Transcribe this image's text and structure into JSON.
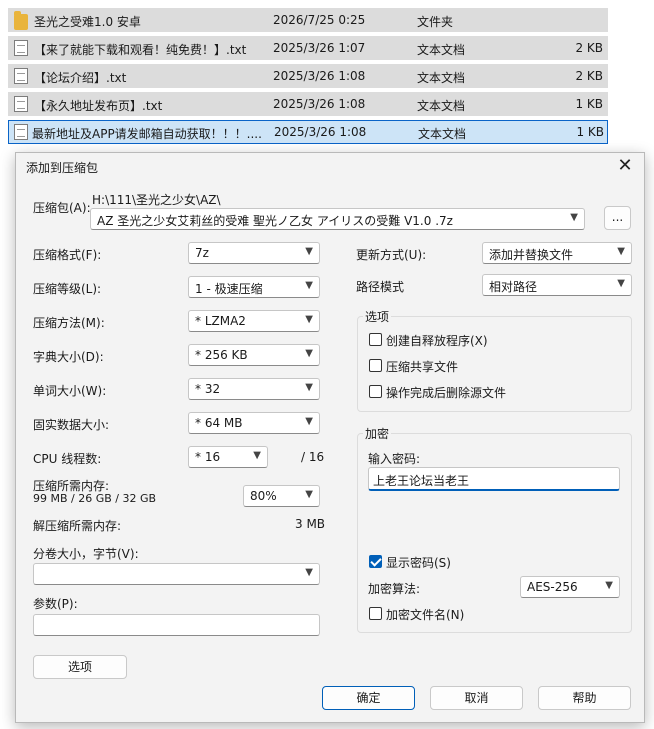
{
  "files": [
    {
      "name": "圣光之受难1.0 安卓",
      "date": "2026/7/25 0:25",
      "type": "文件夹",
      "size": "",
      "icon": "folder-icon"
    },
    {
      "name": "【来了就能下载和观看！纯免费！】.txt",
      "date": "2025/3/26 1:07",
      "type": "文本文档",
      "size": "2 KB",
      "icon": "text-file-icon"
    },
    {
      "name": "【论坛介绍】.txt",
      "date": "2025/3/26 1:08",
      "type": "文本文档",
      "size": "2 KB",
      "icon": "text-file-icon"
    },
    {
      "name": "【永久地址发布页】.txt",
      "date": "2025/3/26 1:08",
      "type": "文本文档",
      "size": "1 KB",
      "icon": "text-file-icon"
    },
    {
      "name": "最新地址及APP请发邮箱自动获取！！！....",
      "date": "2025/3/26 1:08",
      "type": "文本文档",
      "size": "1 KB",
      "icon": "text-file-icon"
    }
  ],
  "dialog": {
    "title": "添加到压缩包",
    "close": "✕",
    "archive_label": "压缩包(A):",
    "archive_path": "H:\\111\\圣光之少女\\AZ\\",
    "archive_name": "AZ 圣光之少女艾莉丝的受难 聖光ノ乙女 アイリスの受難 V1.0 .7z",
    "browse_label": "...",
    "format_label": "压缩格式(F):",
    "format_value": "7z",
    "level_label": "压缩等级(L):",
    "level_value": "1 - 极速压缩",
    "method_label": "压缩方法(M):",
    "method_value": "*  LZMA2",
    "dict_label": "字典大小(D):",
    "dict_value": "*  256 KB",
    "word_label": "单词大小(W):",
    "word_value": "*  32",
    "solid_label": "固实数据大小:",
    "solid_value": "*  64 MB",
    "cpu_label": "CPU 线程数:",
    "cpu_value": "*  16",
    "cpu_total": "/ 16",
    "mem_label": "压缩所需内存:",
    "mem_detail": "99 MB / 26 GB / 32 GB",
    "mem_percent": "80%",
    "decomp_label": "解压缩所需内存:",
    "decomp_value": "3 MB",
    "split_label": "分卷大小，字节(V):",
    "split_value": "",
    "params_label": "参数(P):",
    "params_value": "",
    "options_button": "选项",
    "update_label": "更新方式(U):",
    "update_value": "添加并替换文件",
    "path_label": "路径模式",
    "path_value": "相对路径",
    "options_group": "选项",
    "opt_sfx": "创建自释放程序(X)",
    "opt_shared": "压缩共享文件",
    "opt_delete": "操作完成后删除源文件",
    "encrypt_group": "加密",
    "password_label": "输入密码:",
    "password_value": "上老王论坛当老王",
    "show_password": "显示密码(S)",
    "algo_label": "加密算法:",
    "algo_value": "AES-256",
    "encrypt_names": "加密文件名(N)",
    "ok": "确定",
    "cancel": "取消",
    "help": "帮助"
  }
}
